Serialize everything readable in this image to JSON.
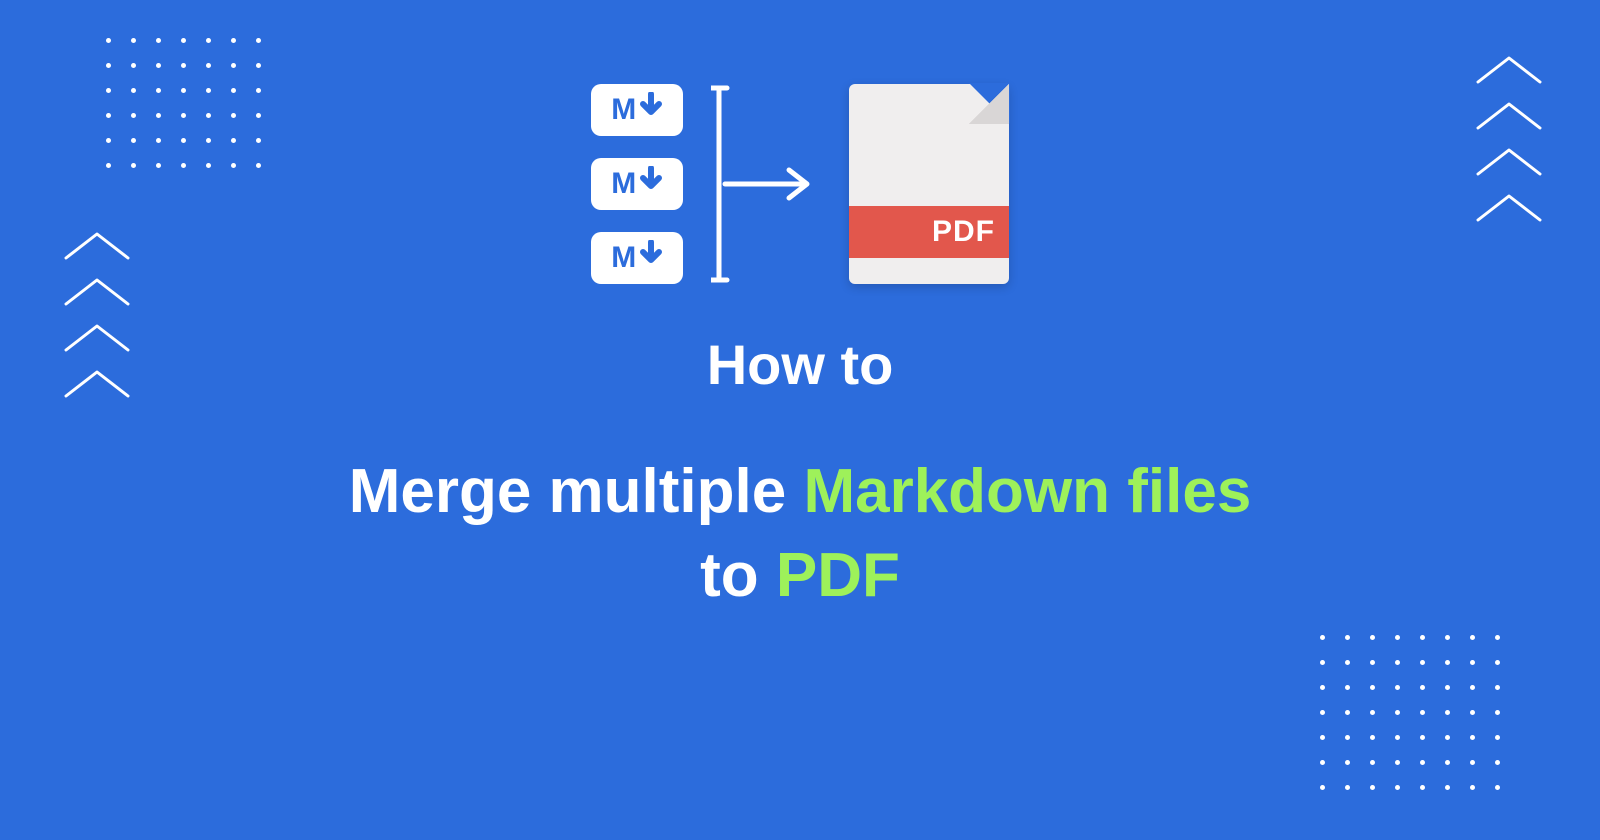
{
  "md_label": "M",
  "pdf_band": "PDF",
  "howto": "How to",
  "title_part1": "Merge multiple ",
  "title_accent1": "Markdown files",
  "title_part2": "to ",
  "title_accent2": "PDF"
}
